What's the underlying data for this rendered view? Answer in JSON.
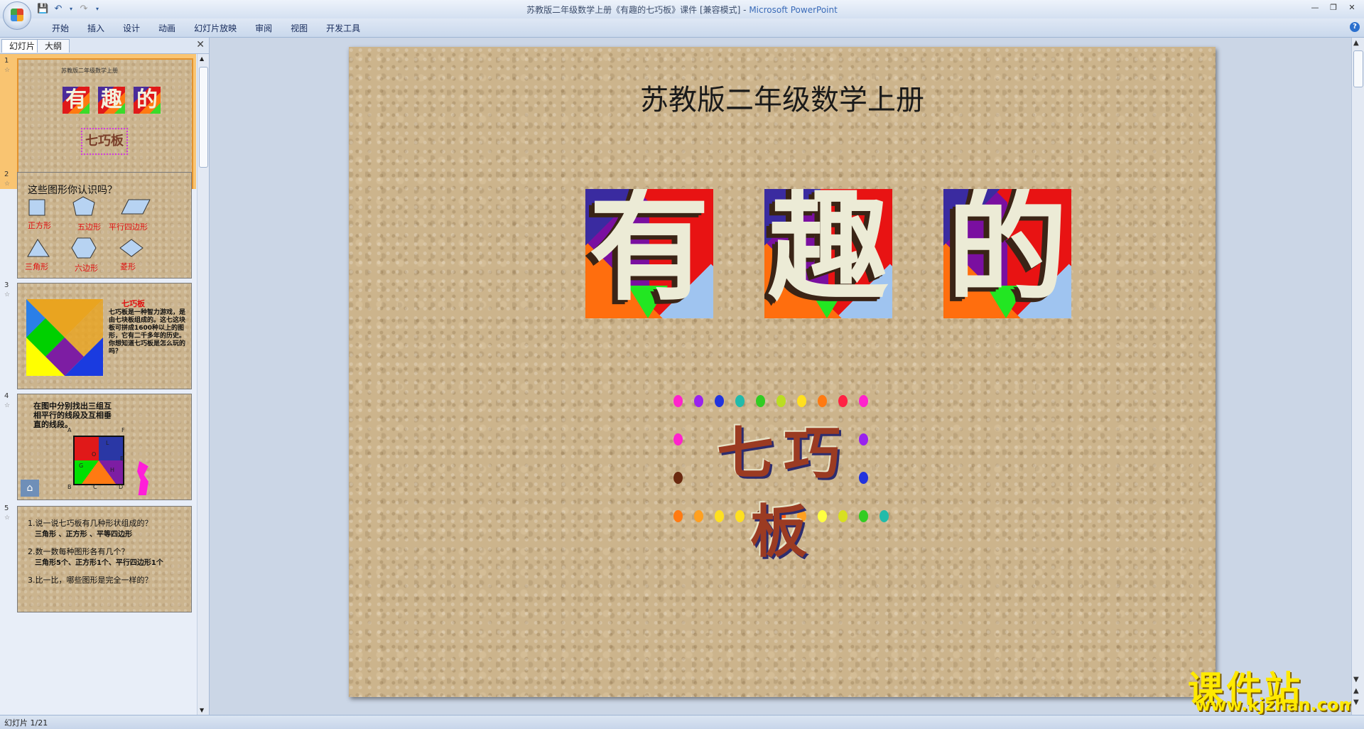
{
  "window": {
    "title_doc": "苏教版二年级数学上册《有趣的七巧板》课件 [兼容模式] - ",
    "title_app": "Microsoft PowerPoint"
  },
  "ribbon": {
    "tabs": [
      "开始",
      "插入",
      "设计",
      "动画",
      "幻灯片放映",
      "审阅",
      "视图",
      "开发工具"
    ]
  },
  "left_panel": {
    "tabs": [
      "幻灯片",
      "大纲"
    ],
    "slides": [
      {
        "num": "1",
        "sub": "苏教版二年级数学上册",
        "chars": [
          "有",
          "趣",
          "的"
        ],
        "qqb": "七巧板"
      },
      {
        "num": "2",
        "title": "这些图形你认识吗？",
        "labels": [
          "正方形",
          "五边形",
          "平行四边形",
          "三角形",
          "六边形",
          "菱形"
        ]
      },
      {
        "num": "3",
        "title": "七巧板",
        "text": "七巧板是一种智力游戏，是由七块板组成的。这七这块板可拼成1600种以上的图形，它有二千多年的历史。你想知道七巧板是怎么玩的吗？"
      },
      {
        "num": "4",
        "text": "在图中分别找出三组互相平行的线段及互相垂直的线段。",
        "points": [
          "A",
          "F",
          "B",
          "C",
          "D",
          "G",
          "H",
          "E",
          "L",
          "O"
        ]
      },
      {
        "num": "5",
        "q1": "1.说一说七巧板有几种形状组成的？",
        "a1": "三角形 、正方形 、平等四边形",
        "q2": "2.数一数每种图形各有几个？",
        "a2": "三角形5个、正方形1个、平行四边形1个",
        "q3": "3.比一比，哪些图形是完全一样的？"
      }
    ]
  },
  "slide": {
    "subtitle": "苏教版二年级数学上册",
    "chars": [
      "有",
      "趣",
      "的"
    ],
    "qqb": "七巧板"
  },
  "watermark": {
    "line1": "课件站",
    "line2": "www.kjzhan.com"
  },
  "status": {
    "text": "幻灯片 1/21"
  }
}
